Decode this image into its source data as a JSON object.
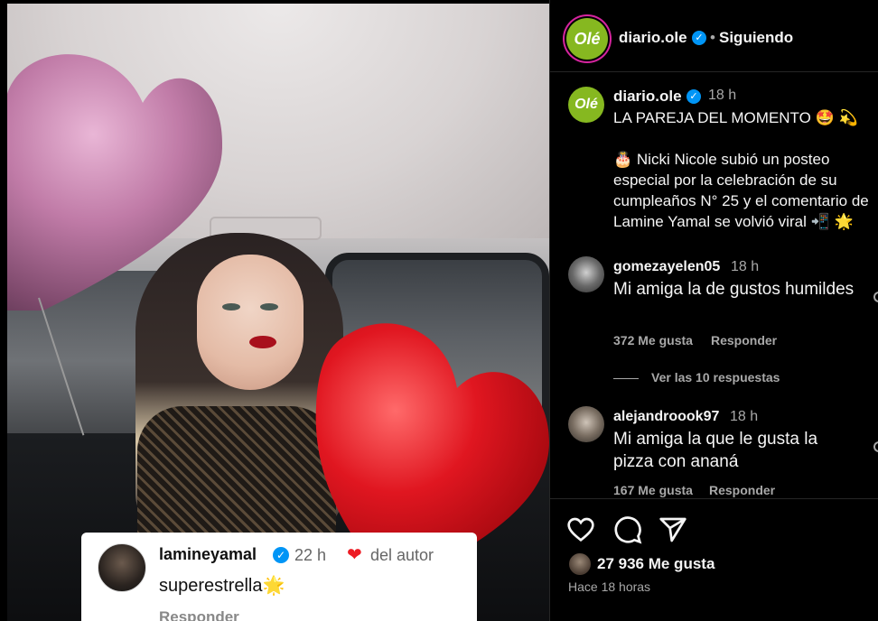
{
  "post": {
    "account": "diario.ole",
    "logo_text": "Olé",
    "dot": "•",
    "follow_status": "Siguiendo"
  },
  "overlay_comment": {
    "user": "lamineyamal",
    "time": "22 h",
    "author_tag": "del autor",
    "text": "superestrella🌟",
    "reply": "Responder"
  },
  "caption": {
    "user": "diario.ole",
    "time": "18 h",
    "line1": "LA PAREJA DEL MOMENTO 🤩 💫",
    "body": "🎂 Nicki Nicole subió un posteo especial por la celebración de su cumpleaños N° 25 y el comentario de Lamine Yamal se volvió viral 📲 🌟"
  },
  "comments": [
    {
      "user": "gomezayelen05",
      "time": "18 h",
      "text": "Mi amiga la de gustos humildes",
      "likes": "372 Me gusta",
      "reply": "Responder"
    },
    {
      "user": "alejandroook97",
      "time": "18 h",
      "text": "Mi amiga la que le gusta la pizza con ananá",
      "likes": "167 Me gusta",
      "reply": "Responder"
    }
  ],
  "view_replies": "Ver las 10 respuestas",
  "likes_count": "27 936 Me gusta",
  "time_ago": "Hace 18 horas",
  "icons": {
    "like": "heart-icon",
    "comment": "comment-icon",
    "share": "share-icon",
    "verified": "verified-badge-icon"
  },
  "colors": {
    "brand_green": "#86b820",
    "verified_blue": "#0095f6",
    "heart_red": "#ed1c24"
  }
}
